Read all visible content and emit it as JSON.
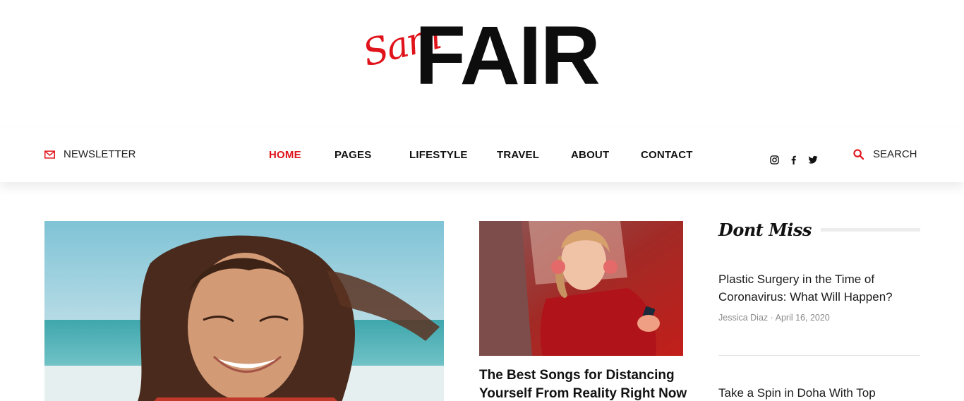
{
  "logo": {
    "script": "Sam",
    "word": "FAIR"
  },
  "nav": {
    "newsletter": "NEWSLETTER",
    "items": [
      {
        "label": "HOME",
        "active": true
      },
      {
        "label": "PAGES",
        "active": false
      },
      {
        "label": "LIFESTYLE",
        "active": false
      },
      {
        "label": "TRAVEL",
        "active": false
      },
      {
        "label": "ABOUT",
        "active": false
      },
      {
        "label": "CONTACT",
        "active": false
      }
    ],
    "social": [
      "instagram-icon",
      "facebook-icon",
      "twitter-icon"
    ],
    "search": "SEARCH"
  },
  "featured": {
    "title": "The Best Songs for Distancing Yourself From Reality Right Now"
  },
  "sidebar": {
    "title": "Dont Miss",
    "items": [
      {
        "title": "Plastic Surgery in the Time of Coronavirus: What Will Happen?",
        "author": "Jessica Diaz",
        "sep": "·",
        "date": "April 16, 2020"
      },
      {
        "title": "Take a Spin in Doha With Top"
      }
    ]
  },
  "colors": {
    "accent": "#e0131b",
    "text": "#111111",
    "meta": "#8a8a8a"
  }
}
